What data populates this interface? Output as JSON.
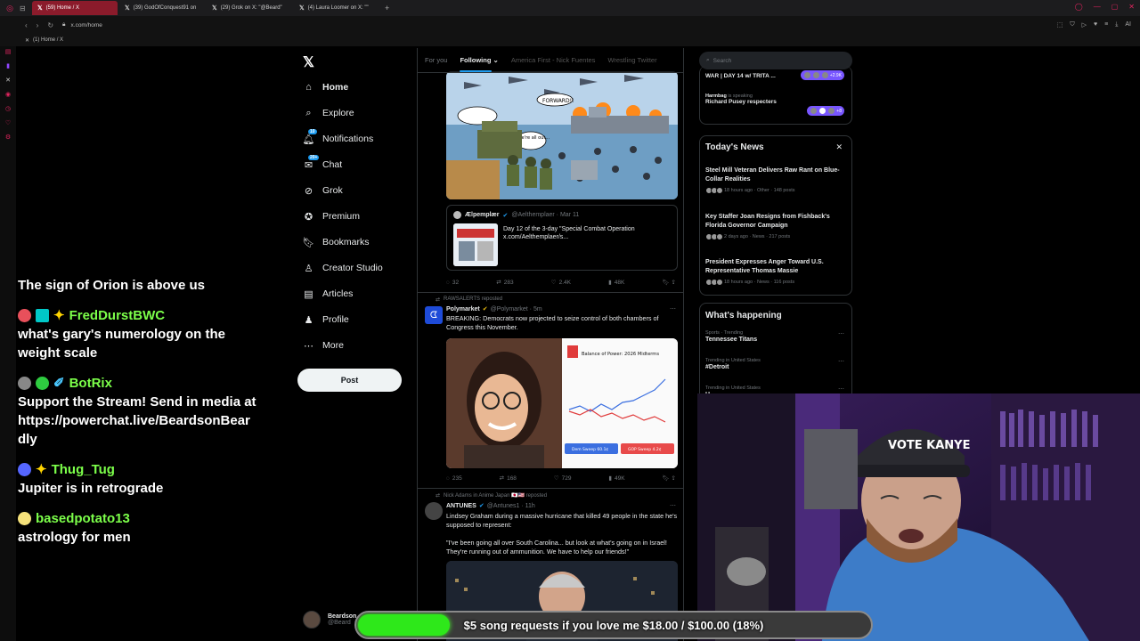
{
  "browser": {
    "tabs": [
      {
        "label": "(59) Home / X",
        "active": true
      },
      {
        "label": "(39) GodOfConquest91 on",
        "active": false
      },
      {
        "label": "(29) Grok on X: \"@Beard\"",
        "active": false
      },
      {
        "label": "(4) Laura Loomer on X: \"\"",
        "active": false
      }
    ],
    "url": "x.com/home",
    "bookmark": "(1) Home / X"
  },
  "chat": [
    {
      "text": "The sign of Orion is above us"
    },
    {
      "user": "FredDurstBWC",
      "text": "what's gary's numerology on the weight scale"
    },
    {
      "user": "BotRix",
      "text": "Support the Stream! Send in media at https://powerchat.live/BeardsonBeardly"
    },
    {
      "user": "Thug_Tug",
      "text": "Jupiter is in retrograde"
    },
    {
      "user": "basedpotato13",
      "text": "astrology for men"
    }
  ],
  "sidebar": {
    "items": [
      {
        "label": "Home",
        "icon": "home-icon"
      },
      {
        "label": "Explore",
        "icon": "search-icon"
      },
      {
        "label": "Notifications",
        "icon": "bell-icon",
        "count": "10"
      },
      {
        "label": "Chat",
        "icon": "chat-icon",
        "count": "20+"
      },
      {
        "label": "Grok",
        "icon": "grok-icon"
      },
      {
        "label": "Premium",
        "icon": "premium-icon"
      },
      {
        "label": "Bookmarks",
        "icon": "bookmark-icon"
      },
      {
        "label": "Creator Studio",
        "icon": "creator-icon"
      },
      {
        "label": "Articles",
        "icon": "articles-icon"
      },
      {
        "label": "Profile",
        "icon": "profile-icon"
      },
      {
        "label": "More",
        "icon": "more-icon"
      }
    ],
    "post_label": "Post",
    "account_name": "Beardson",
    "account_handle": "@Beard"
  },
  "feed": {
    "tabs": [
      "For you",
      "Following",
      "America First - Nick Fuentes",
      "Wrestling Twitter"
    ],
    "active_tab": "Following",
    "tweet1": {
      "quote_name": "Æl​pemplær",
      "quote_handle": "@Aelthemplaer · Mar 11",
      "quote_text": "Day 12 of the 3-day \"Special Combat Operation x.com/Aelthemplaer/s...",
      "comic_caption_1": "FORWARD!!",
      "comic_caption_2": "We're all out...",
      "stats": {
        "replies": "32",
        "reposts": "283",
        "likes": "2.4K",
        "views": "48K"
      }
    },
    "tweet2": {
      "repost_by": "RAWSALERTS reposted",
      "name": "Polymarket",
      "handle": "@Polymarket · 5m",
      "text": "BREAKING: Democrats now projected to seize control of both chambers of Congress this November.",
      "card_title": "Balance of Power: 2026 Midterms",
      "card_dem": "Dem Sweep 60.1¢",
      "card_gop": "GOP Sweep 4.2¢",
      "stats": {
        "replies": "235",
        "reposts": "168",
        "likes": "729",
        "views": "49K"
      }
    },
    "tweet3": {
      "repost_by": "Nick Adams in Anime Japan 🇯🇵🇺🇸 reposted",
      "name": "ANTUNES",
      "handle": "@Antunes1 · 11h",
      "text": "Lindsey Graham during a massive hurricane that killed 49 people in the state he's supposed to represent:",
      "quote": "\"I've been going all over South Carolina... but look at what's going on in Israel! They're running out of ammunition. We have to help our friends!\""
    }
  },
  "right": {
    "search_placeholder": "Search",
    "spaces": [
      {
        "title": "WAR | DAY 14 w/ TRITA ...",
        "count": "+2.9K"
      },
      {
        "host": "Harmbag",
        "status": "is speaking",
        "title": "Richard Pusey respecters",
        "count": "+8"
      }
    ],
    "news_title": "Today's News",
    "news": [
      {
        "title": "Steel Mill Veteran Delivers Raw Rant on Blue-Collar Realities",
        "meta": "18 hours ago · Other · 148 posts"
      },
      {
        "title": "Key Staffer Joan Resigns from Fishback's Florida Governor Campaign",
        "meta": "2 days ago · News · 217 posts"
      },
      {
        "title": "President Expresses Anger Toward U.S. Representative Thomas Massie",
        "meta": "18 hours ago · News · 116 posts"
      }
    ],
    "happening_title": "What's happening",
    "trends": [
      {
        "category": "Sports · Trending",
        "name": "Tennessee Titans"
      },
      {
        "category": "Trending in United States",
        "name": "#Detroit"
      },
      {
        "category": "Trending in United States",
        "name": "H"
      }
    ]
  },
  "goal": {
    "label": "$5 song requests if you love me $18.00 / $100.00 (18%)",
    "progress": 0.18,
    "color": "#2ee81a"
  },
  "webcam": {
    "hat_text": "VOTE KANYE"
  },
  "colors": {
    "accent": "#1d9bf0",
    "chat_user": "#7cff4a",
    "tab_active": "#8b1b2b"
  }
}
